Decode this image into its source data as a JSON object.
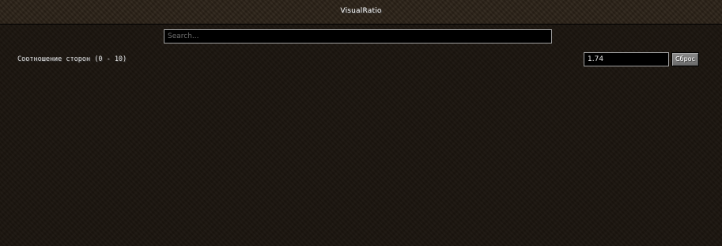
{
  "header": {
    "title": "VisualRatio"
  },
  "search": {
    "placeholder": "Search..."
  },
  "options": [
    {
      "label": "Соотношение сторон (0 - 10)",
      "value": "1.74",
      "reset_label": "Сброс"
    }
  ]
}
